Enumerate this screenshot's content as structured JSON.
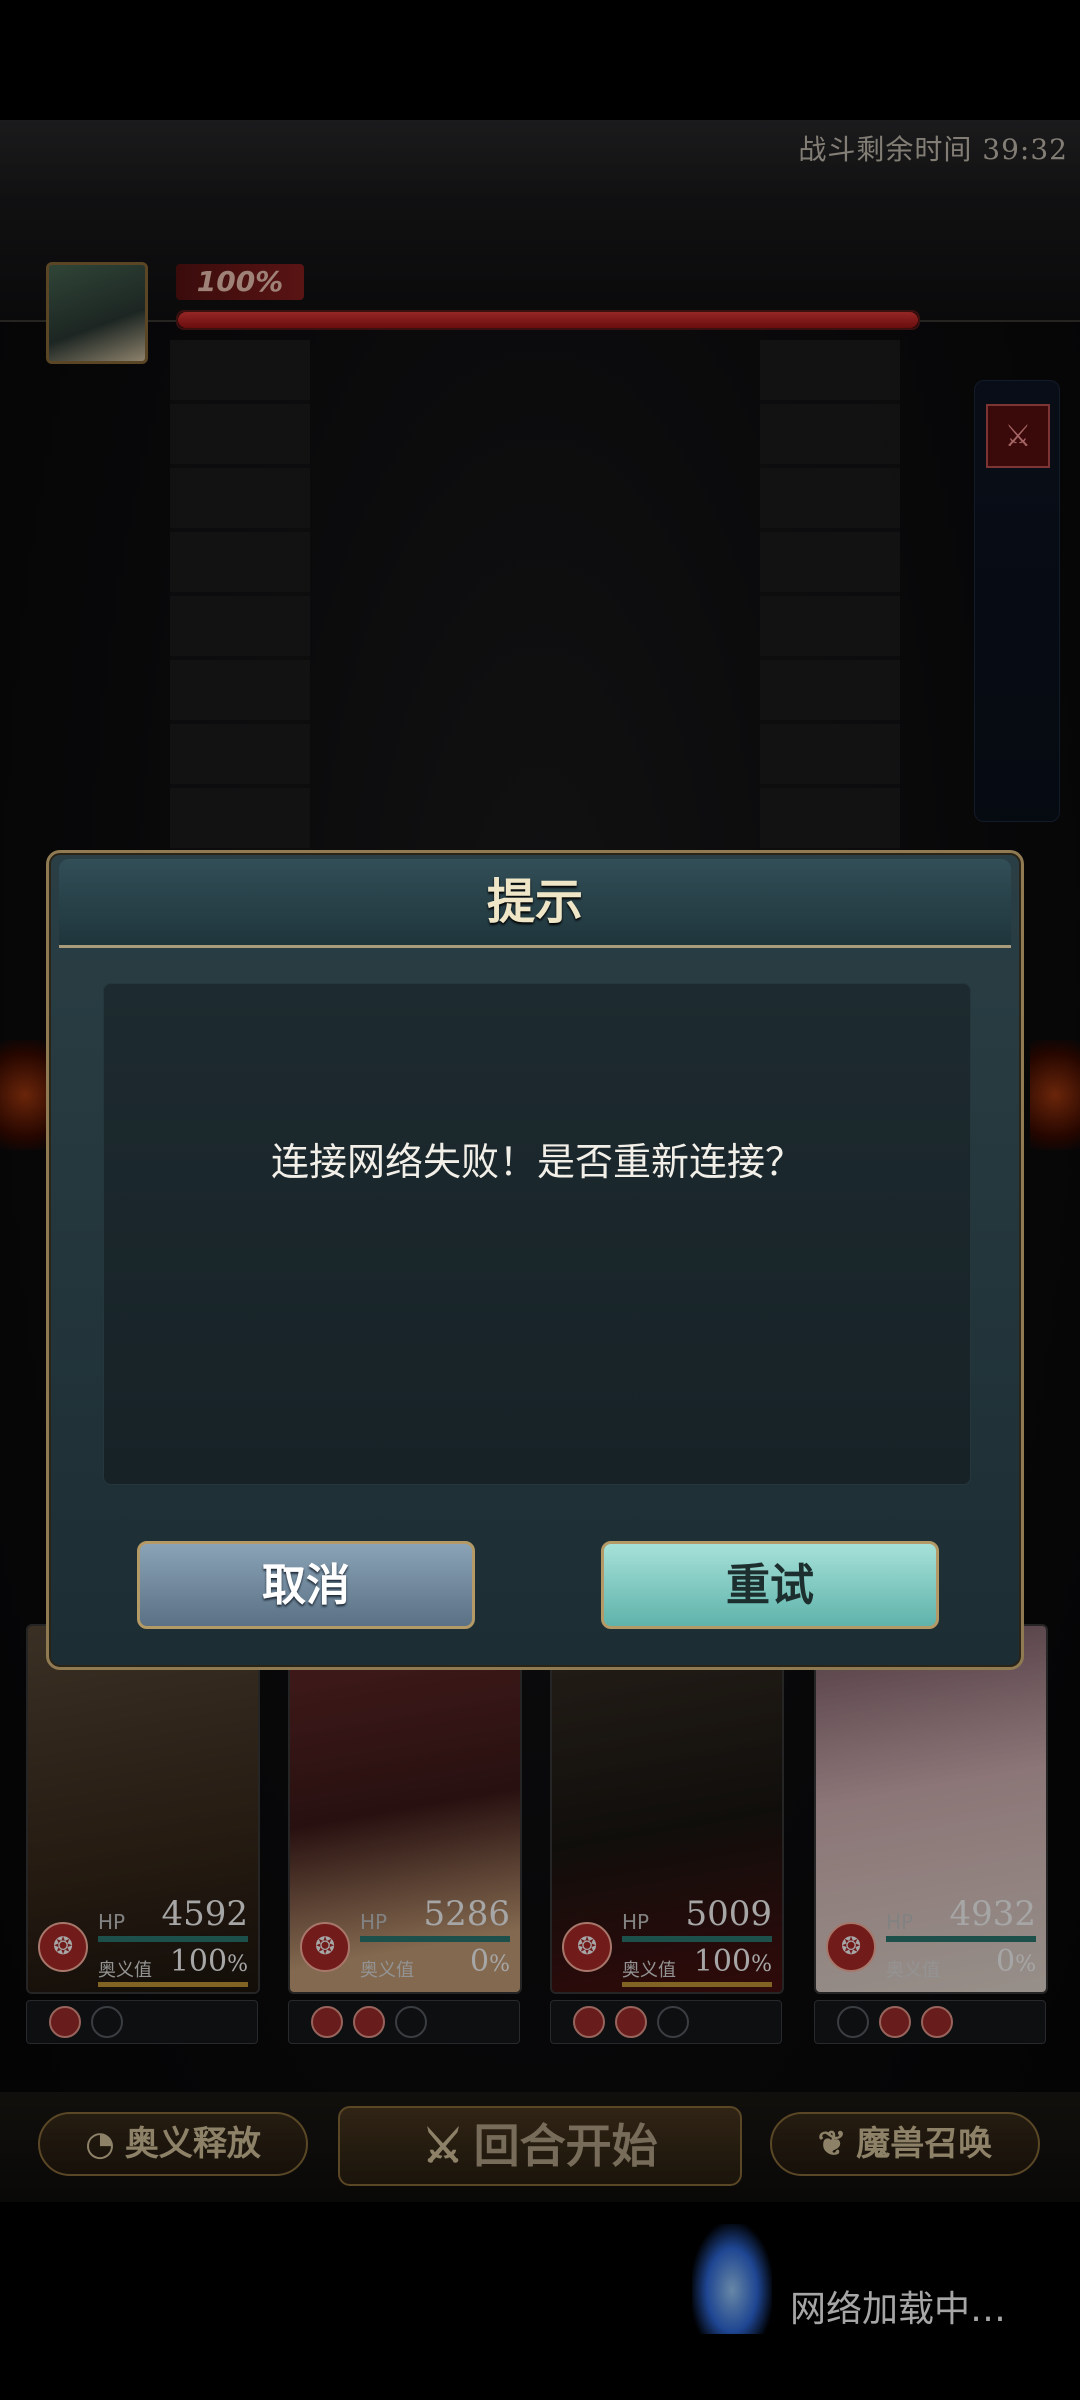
{
  "battle": {
    "timer_text": "战斗剩余时间 39:32",
    "boss_hp_percent_text": "100%",
    "boss_hp_fraction": 1.0
  },
  "dialog": {
    "title": "提示",
    "message": "连接网络失败！是否重新连接？",
    "cancel_label": "取消",
    "retry_label": "重试"
  },
  "party": [
    {
      "hp_label": "HP",
      "hp": "4592",
      "ougi_label": "奥义值",
      "ougi": "100",
      "ougi_unit": "%",
      "slots": [
        "red",
        "empty"
      ]
    },
    {
      "hp_label": "HP",
      "hp": "5286",
      "ougi_label": "奥义值",
      "ougi": "0",
      "ougi_unit": "%",
      "slots": [
        "red",
        "red",
        "empty"
      ]
    },
    {
      "hp_label": "HP",
      "hp": "5009",
      "ougi_label": "奥义值",
      "ougi": "100",
      "ougi_unit": "%",
      "slots": [
        "red",
        "red",
        "empty"
      ]
    },
    {
      "hp_label": "HP",
      "hp": "4932",
      "ougi_label": "奥义值",
      "ougi": "0",
      "ougi_unit": "%",
      "slots": [
        "empty",
        "red",
        "red"
      ]
    }
  ],
  "bottom_bar": {
    "ougi_release_label": "奥义释放",
    "turn_start_label": "回合开始",
    "summon_label": "魔兽召唤"
  },
  "status": {
    "loading_text": "网络加载中…"
  },
  "icons": {
    "element": "fire-icon",
    "sword": "crossed-swords-icon",
    "spiral": "spiral-icon",
    "beast": "dragon-icon",
    "buff": "attack-debuff-icon"
  },
  "colors": {
    "dialog_border": "#8f7a52",
    "retry_button": "#5fb3ab",
    "cancel_button": "#5b7185",
    "boss_hp": "#e53b3b"
  }
}
